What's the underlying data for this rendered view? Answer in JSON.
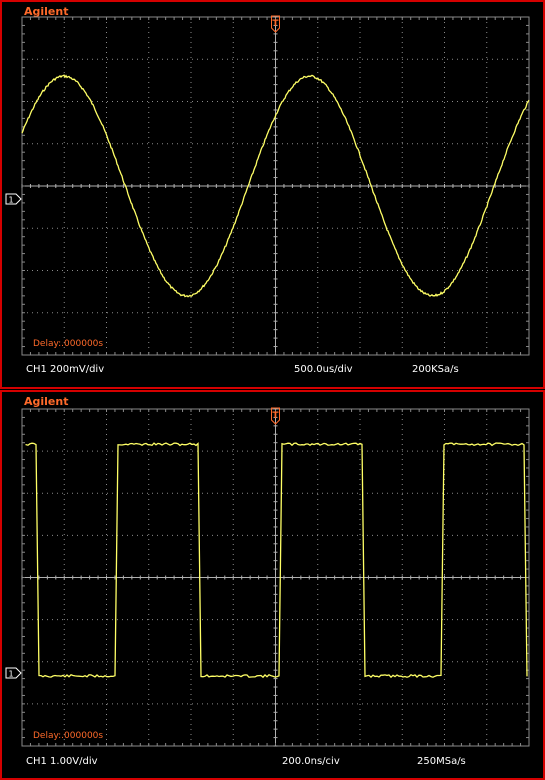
{
  "colors": {
    "trace": "#ffff66",
    "brand": "#ff6a2a",
    "border": "#d40000",
    "grid": "#8a8a8a",
    "text": "#ffffff"
  },
  "screens": [
    {
      "brand": "Agilent",
      "delay": "Delay:.000000s",
      "channel_scale": "CH1 200mV/div",
      "timebase": "500.0us/div",
      "sample_rate": "200KSa/s",
      "waveform": "sine",
      "channel_marker": "1",
      "trigger_marker": "T"
    },
    {
      "brand": "Agilent",
      "delay": "Delay:.000000s",
      "channel_scale": "CH1 1.00V/div",
      "timebase": "200.0ns/civ",
      "sample_rate": "250MSa/s",
      "waveform": "square",
      "channel_marker": "1",
      "trigger_marker": "T"
    }
  ]
}
